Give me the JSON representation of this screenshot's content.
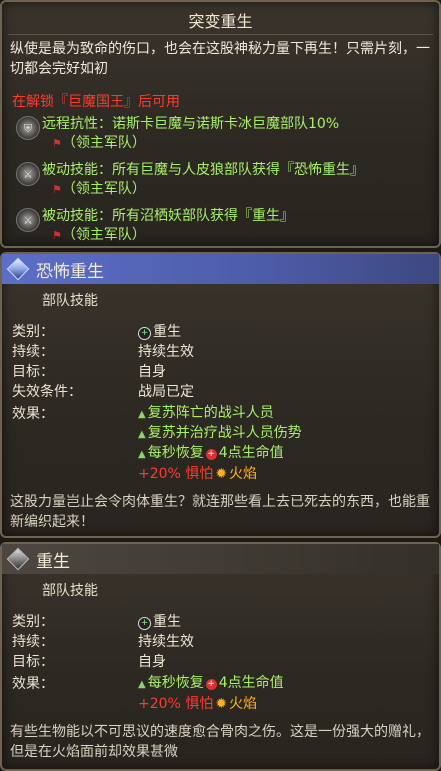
{
  "tooltip": {
    "title": "突变重生",
    "description": "纵使是最为致命的伤口，也会在这股神秘力量下再生！只需片刻，一切都会完好如初",
    "unlock_text": "在解锁『巨魔国王』后可用",
    "lines": [
      {
        "icon": "shield-icon",
        "text": "远程抗性：诺斯卡巨魔与诺斯卡冰巨魔部队10%",
        "sub": "（领主军队）"
      },
      {
        "icon": "crossed-swords-icon",
        "text": "被动技能：所有巨魔与人皮狼部队获得『恐怖重生』",
        "sub": "（领主军队）"
      },
      {
        "icon": "crossed-swords-icon",
        "text": "被动技能：所有沼栖妖部队获得『重生』",
        "sub": "（领主军队）"
      }
    ]
  },
  "skill1": {
    "name": "恐怖重生",
    "type": "部队技能",
    "rows": [
      {
        "k": "类别：",
        "v": "重生"
      },
      {
        "k": "持续：",
        "v": "持续生效"
      },
      {
        "k": "目标：",
        "v": "自身"
      },
      {
        "k": "失效条件：",
        "v": "战局已定"
      }
    ],
    "effects_label": "效果：",
    "effects": [
      "复苏阵亡的战斗人员",
      "复苏并治疗战斗人员伤势",
      "每秒恢复",
      "4点生命值"
    ],
    "effect_fear": "+20% 惧怕",
    "effect_fire": "火焰",
    "flavor": "这股力量岂止会令肉体重生？就连那些看上去已死去的东西，也能重新编织起来！"
  },
  "skill2": {
    "name": "重生",
    "type": "部队技能",
    "rows": [
      {
        "k": "类别：",
        "v": "重生"
      },
      {
        "k": "持续：",
        "v": "持续生效"
      },
      {
        "k": "目标：",
        "v": "自身"
      }
    ],
    "effects_label": "效果：",
    "effects": [
      "每秒恢复",
      "4点生命值"
    ],
    "effect_fear": "+20% 惧怕",
    "effect_fire": "火焰",
    "flavor": "有些生物能以不可思议的速度愈合骨肉之伤。这是一份强大的赠礼，但是在火焰面前却效果甚微"
  }
}
